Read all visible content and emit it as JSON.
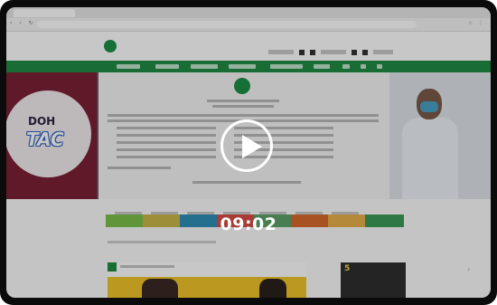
{
  "video": {
    "duration": "09:02",
    "play_icon": "play-icon"
  },
  "banner": {
    "doh_label": "DOH",
    "tac_label": "TAC"
  },
  "accent_colors": {
    "nav_green": "#1f8b43",
    "banner_maroon": "#7b2134"
  },
  "color_bar": [
    {
      "color": "#7bbf4b"
    },
    {
      "color": "#c9b84a"
    },
    {
      "color": "#2f8fb7"
    },
    {
      "color": "#d94f45"
    },
    {
      "color": "#5ea06a"
    },
    {
      "color": "#d86a2f"
    },
    {
      "color": "#e8b04b"
    },
    {
      "color": "#3c9a56"
    }
  ],
  "side_card": {
    "title": "5"
  }
}
